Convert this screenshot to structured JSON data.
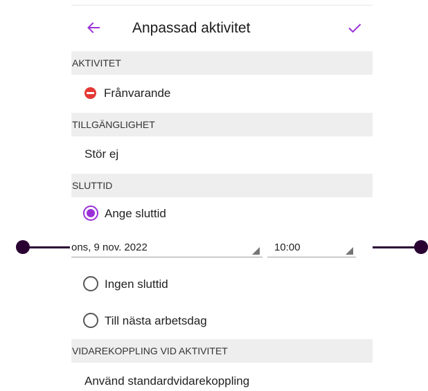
{
  "header": {
    "title": "Anpassad aktivitet",
    "back_icon": "arrow-left-icon",
    "confirm_icon": "check-icon",
    "accent_color": "#9b30d9"
  },
  "activity": {
    "section_label": "AKTIVITET",
    "status_label": "Frånvarande",
    "status_icon": "do-not-disturb-icon",
    "status_color": "#e53935"
  },
  "availability": {
    "section_label": "TILLGÄNGLIGHET",
    "value": "Stör ej"
  },
  "end_time": {
    "section_label": "SLUTTID",
    "options": [
      {
        "label": "Ange sluttid",
        "selected": true
      },
      {
        "label": "Ingen sluttid",
        "selected": false
      },
      {
        "label": "Till nästa arbetsdag",
        "selected": false
      }
    ],
    "date_value": "ons, 9 nov. 2022",
    "time_value": "10:00"
  },
  "forwarding": {
    "section_label": "VIDAREKOPPLING VID AKTIVITET",
    "value": "Använd standardvidarekoppling"
  }
}
